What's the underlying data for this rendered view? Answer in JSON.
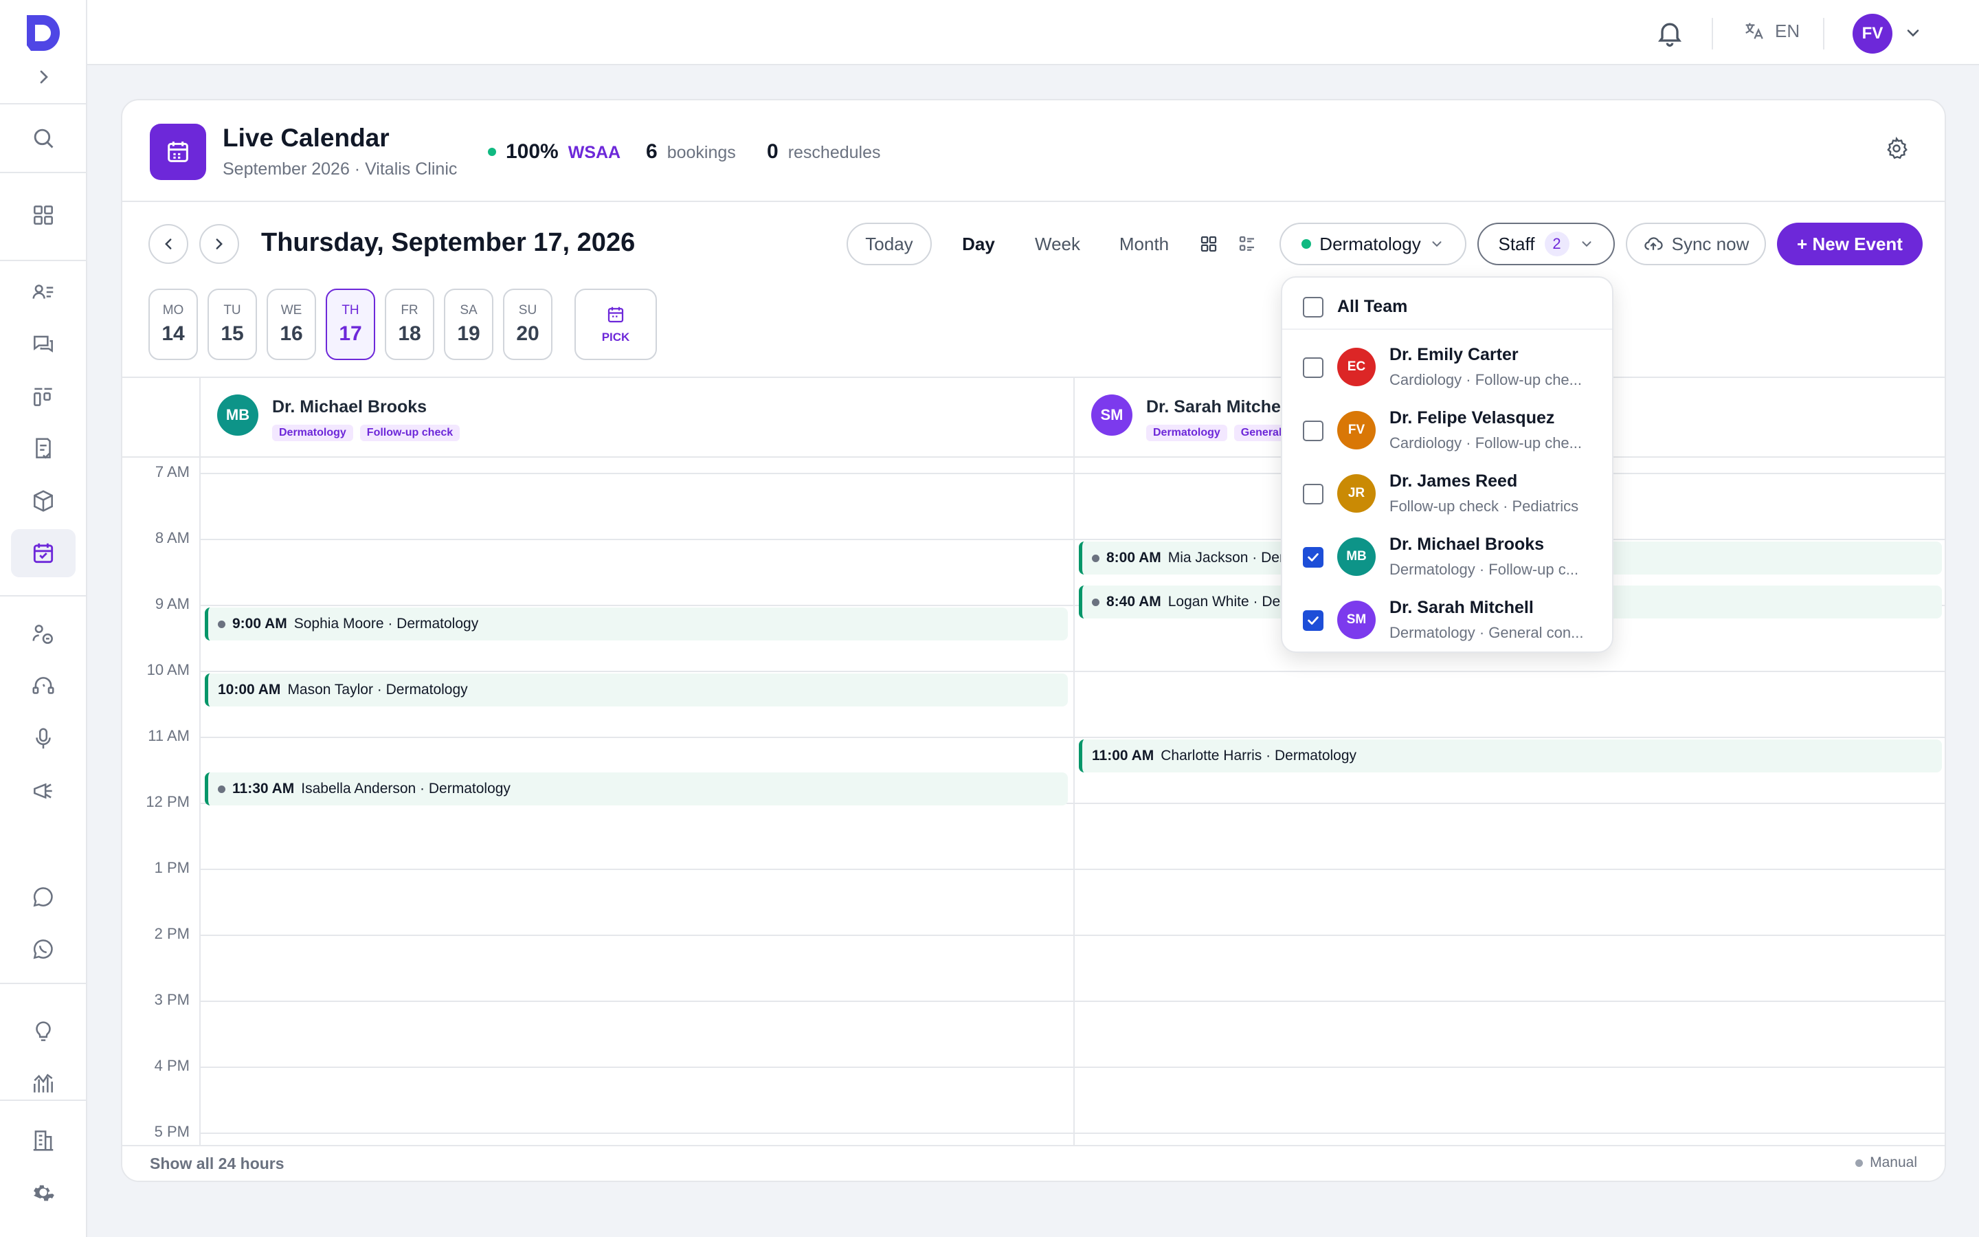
{
  "topbar": {
    "language": "EN",
    "user_initials": "FV"
  },
  "header": {
    "title": "Live Calendar",
    "subtitle": "September 2026 · Vitalis Clinic",
    "stats": [
      {
        "value": "100%",
        "label": "WSAA"
      },
      {
        "value": "6",
        "label": "bookings"
      },
      {
        "value": "0",
        "label": "reschedules"
      }
    ]
  },
  "toolbar": {
    "date_title": "Thursday, September 17, 2026",
    "today": "Today",
    "views": [
      "Day",
      "Week",
      "Month"
    ],
    "active_view": "Day",
    "department": "Dermatology",
    "staff_label": "Staff",
    "staff_count": "2",
    "sync": "Sync now",
    "new_event": "+ New Event"
  },
  "days": [
    {
      "dow": "MO",
      "date": "14"
    },
    {
      "dow": "TU",
      "date": "15"
    },
    {
      "dow": "WE",
      "date": "16"
    },
    {
      "dow": "TH",
      "date": "17",
      "active": true
    },
    {
      "dow": "FR",
      "date": "18"
    },
    {
      "dow": "SA",
      "date": "19"
    },
    {
      "dow": "SU",
      "date": "20"
    }
  ],
  "pick_label": "PICK",
  "hours": [
    "7 AM",
    "8 AM",
    "9 AM",
    "10 AM",
    "11 AM",
    "12 PM",
    "1 PM",
    "2 PM",
    "3 PM",
    "4 PM",
    "5 PM"
  ],
  "columns": [
    {
      "initials": "MB",
      "name": "Dr. Michael Brooks",
      "color": "#0d9488",
      "tags": [
        "Dermatology",
        "Follow-up check"
      ],
      "events": [
        {
          "time": "9:00 AM",
          "text": "Sophia Moore · Dermatology",
          "start": 9.0,
          "dot": true
        },
        {
          "time": "10:00 AM",
          "text": "Mason Taylor · Dermatology",
          "start": 10.0,
          "dot": false
        },
        {
          "time": "11:30 AM",
          "text": "Isabella Anderson · Dermatology",
          "start": 11.5,
          "dot": true
        }
      ]
    },
    {
      "initials": "SM",
      "name": "Dr. Sarah Mitchell",
      "color": "#7c3aed",
      "tags": [
        "Dermatology",
        "General consultation"
      ],
      "events": [
        {
          "time": "8:00 AM",
          "text": "Mia Jackson · Dermatology",
          "start": 8.0,
          "dot": true
        },
        {
          "time": "8:40 AM",
          "text": "Logan White · Dermatology",
          "start": 8.667,
          "dot": true
        },
        {
          "time": "11:00 AM",
          "text": "Charlotte Harris · Dermatology",
          "start": 11.0,
          "dot": false
        }
      ]
    }
  ],
  "footer": {
    "show_all": "Show all 24 hours",
    "mode": "Manual"
  },
  "staff_dropdown": {
    "all_label": "All Team",
    "items": [
      {
        "initials": "EC",
        "name": "Dr. Emily Carter",
        "sub": "Cardiology · Follow-up che...",
        "color": "#dc2626",
        "checked": false
      },
      {
        "initials": "FV",
        "name": "Dr. Felipe Velasquez",
        "sub": "Cardiology · Follow-up che...",
        "color": "#d97706",
        "checked": false
      },
      {
        "initials": "JR",
        "name": "Dr. James Reed",
        "sub": "Follow-up check · Pediatrics",
        "color": "#ca8a04",
        "checked": false
      },
      {
        "initials": "MB",
        "name": "Dr. Michael Brooks",
        "sub": "Dermatology · Follow-up c...",
        "color": "#0d9488",
        "checked": true
      },
      {
        "initials": "SM",
        "name": "Dr. Sarah Mitchell",
        "sub": "Dermatology · General con...",
        "color": "#7c3aed",
        "checked": true
      }
    ]
  }
}
